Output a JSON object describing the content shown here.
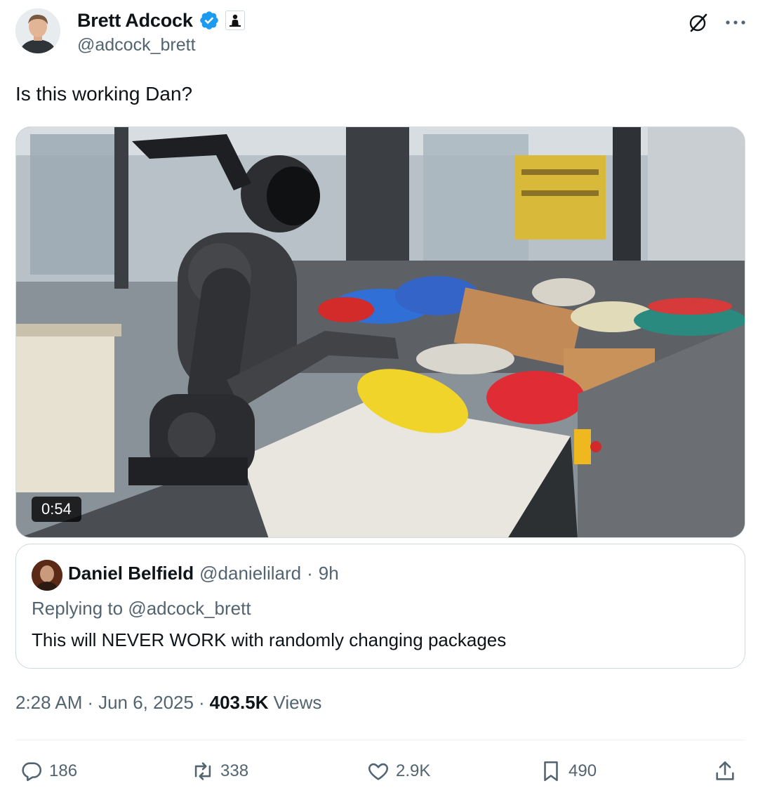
{
  "author": {
    "name": "Brett Adcock",
    "handle": "@adcock_brett",
    "verified_color": "#1d9bf0"
  },
  "header_icons": {
    "grok": "grok-icon",
    "more": "more-icon"
  },
  "tweet": {
    "text": "Is this working Dan?"
  },
  "media": {
    "duration": "0:54"
  },
  "quote": {
    "name": "Daniel Belfield",
    "handle": "@danielilard",
    "separator": "·",
    "time": "9h",
    "replying_prefix": "Replying to",
    "replying_handle": "@adcock_brett",
    "text": "This will NEVER WORK with randomly changing packages"
  },
  "meta": {
    "time": "2:28 AM",
    "sep1": "·",
    "date": "Jun 6, 2025",
    "sep2": "·",
    "views_count": "403.5K",
    "views_label": "Views"
  },
  "actions": {
    "replies": "186",
    "reposts": "338",
    "likes": "2.9K",
    "bookmarks": "490"
  },
  "colors": {
    "text": "#0f1419",
    "muted": "#536471",
    "border": "#cfd9de",
    "accent": "#1d9bf0"
  }
}
